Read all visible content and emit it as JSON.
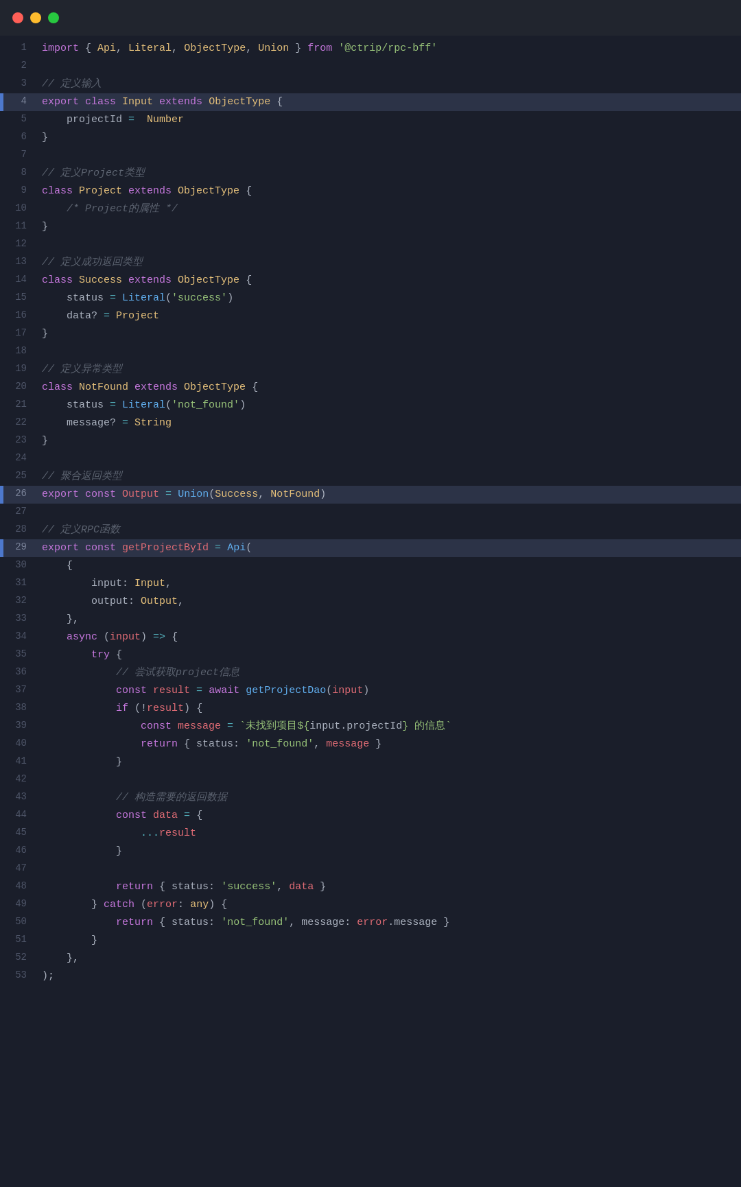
{
  "titlebar": {
    "dots": [
      "red",
      "yellow",
      "green"
    ]
  },
  "lines": [
    {
      "num": 1,
      "highlighted": false,
      "active": false
    },
    {
      "num": 2,
      "highlighted": false,
      "active": false
    },
    {
      "num": 3,
      "highlighted": false,
      "active": false
    },
    {
      "num": 4,
      "highlighted": true,
      "active": true
    },
    {
      "num": 5,
      "highlighted": false,
      "active": false
    },
    {
      "num": 6,
      "highlighted": false,
      "active": false
    },
    {
      "num": 7,
      "highlighted": false,
      "active": false
    },
    {
      "num": 8,
      "highlighted": false,
      "active": false
    },
    {
      "num": 9,
      "highlighted": false,
      "active": false
    },
    {
      "num": 10,
      "highlighted": false,
      "active": false
    },
    {
      "num": 11,
      "highlighted": false,
      "active": false
    },
    {
      "num": 12,
      "highlighted": false,
      "active": false
    },
    {
      "num": 13,
      "highlighted": false,
      "active": false
    },
    {
      "num": 14,
      "highlighted": false,
      "active": false
    },
    {
      "num": 15,
      "highlighted": false,
      "active": false
    },
    {
      "num": 16,
      "highlighted": false,
      "active": false
    },
    {
      "num": 17,
      "highlighted": false,
      "active": false
    },
    {
      "num": 18,
      "highlighted": false,
      "active": false
    },
    {
      "num": 19,
      "highlighted": false,
      "active": false
    },
    {
      "num": 20,
      "highlighted": false,
      "active": false
    },
    {
      "num": 21,
      "highlighted": false,
      "active": false
    },
    {
      "num": 22,
      "highlighted": false,
      "active": false
    },
    {
      "num": 23,
      "highlighted": false,
      "active": false
    },
    {
      "num": 24,
      "highlighted": false,
      "active": false
    },
    {
      "num": 25,
      "highlighted": false,
      "active": false
    },
    {
      "num": 26,
      "highlighted": true,
      "active": true
    },
    {
      "num": 27,
      "highlighted": false,
      "active": false
    },
    {
      "num": 28,
      "highlighted": false,
      "active": false
    },
    {
      "num": 29,
      "highlighted": true,
      "active": true
    },
    {
      "num": 30,
      "highlighted": false,
      "active": false
    },
    {
      "num": 31,
      "highlighted": false,
      "active": false
    },
    {
      "num": 32,
      "highlighted": false,
      "active": false
    },
    {
      "num": 33,
      "highlighted": false,
      "active": false
    },
    {
      "num": 34,
      "highlighted": false,
      "active": false
    },
    {
      "num": 35,
      "highlighted": false,
      "active": false
    },
    {
      "num": 36,
      "highlighted": false,
      "active": false
    },
    {
      "num": 37,
      "highlighted": false,
      "active": false
    },
    {
      "num": 38,
      "highlighted": false,
      "active": false
    },
    {
      "num": 39,
      "highlighted": false,
      "active": false
    },
    {
      "num": 40,
      "highlighted": false,
      "active": false
    },
    {
      "num": 41,
      "highlighted": false,
      "active": false
    },
    {
      "num": 42,
      "highlighted": false,
      "active": false
    },
    {
      "num": 43,
      "highlighted": false,
      "active": false
    },
    {
      "num": 44,
      "highlighted": false,
      "active": false
    },
    {
      "num": 45,
      "highlighted": false,
      "active": false
    },
    {
      "num": 46,
      "highlighted": false,
      "active": false
    },
    {
      "num": 47,
      "highlighted": false,
      "active": false
    },
    {
      "num": 48,
      "highlighted": false,
      "active": false
    },
    {
      "num": 49,
      "highlighted": false,
      "active": false
    },
    {
      "num": 50,
      "highlighted": false,
      "active": false
    },
    {
      "num": 51,
      "highlighted": false,
      "active": false
    },
    {
      "num": 52,
      "highlighted": false,
      "active": false
    },
    {
      "num": 53,
      "highlighted": false,
      "active": false
    }
  ]
}
